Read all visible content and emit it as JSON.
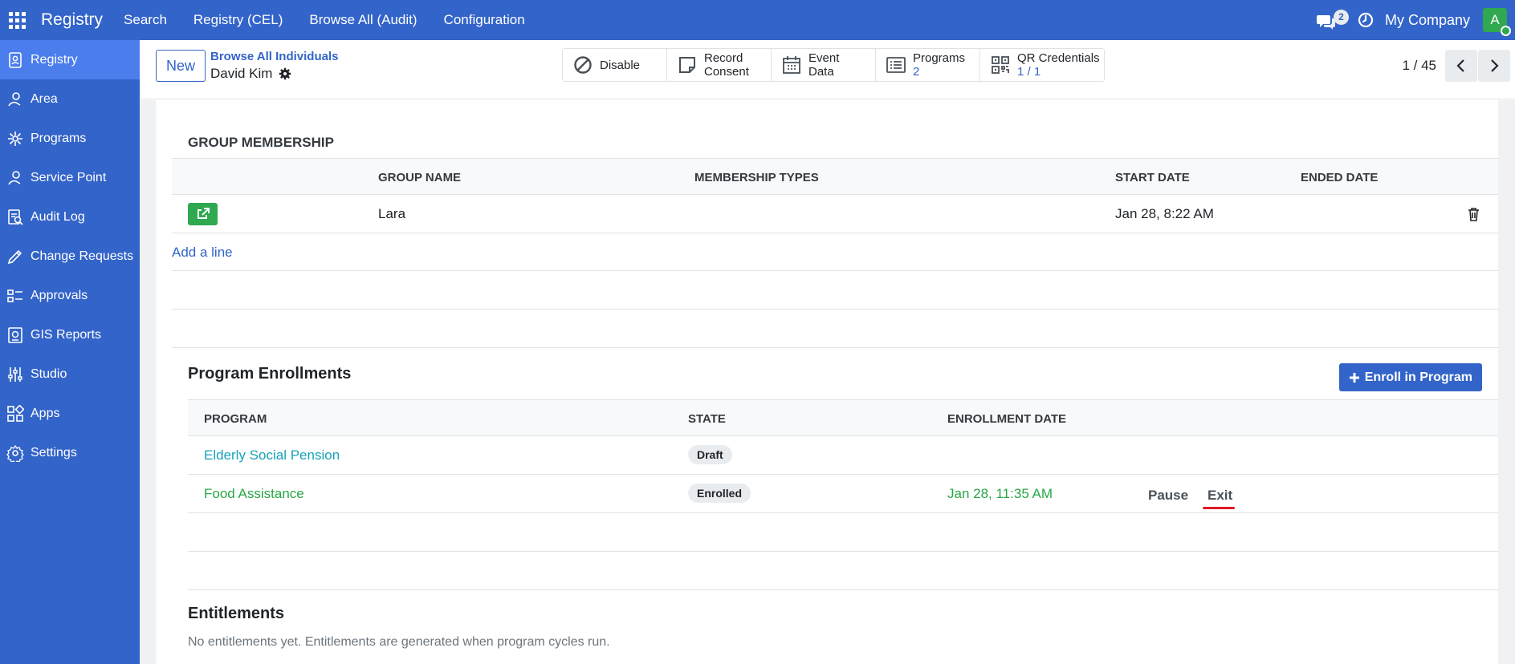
{
  "topbar": {
    "brand": "Registry",
    "menu": [
      "Search",
      "Registry (CEL)",
      "Browse All (Audit)",
      "Configuration"
    ],
    "chat_count": "2",
    "company": "My Company",
    "avatar_letter": "A",
    "icons": [
      "apps-grid-icon",
      "chat-icon",
      "clock-icon"
    ]
  },
  "sidebar": {
    "items": [
      {
        "label": "Registry",
        "icon": "registry-icon",
        "active": true
      },
      {
        "label": "Area",
        "icon": "area-icon"
      },
      {
        "label": "Programs",
        "icon": "programs-icon"
      },
      {
        "label": "Service Point",
        "icon": "service-point-icon"
      },
      {
        "label": "Audit Log",
        "icon": "audit-log-icon"
      },
      {
        "label": "Change Requests",
        "icon": "change-requests-icon"
      },
      {
        "label": "Approvals",
        "icon": "approvals-icon"
      },
      {
        "label": "GIS Reports",
        "icon": "gis-reports-icon"
      },
      {
        "label": "Studio",
        "icon": "studio-icon"
      },
      {
        "label": "Apps",
        "icon": "apps-icon"
      },
      {
        "label": "Settings",
        "icon": "settings-icon"
      }
    ]
  },
  "control": {
    "new_label": "New",
    "breadcrumb_parent": "Browse All Individuals",
    "breadcrumb_current": "David Kim",
    "smart_buttons": {
      "disable": {
        "label": "Disable"
      },
      "record_consent": {
        "line1": "Record",
        "line2": "Consent"
      },
      "event_data": {
        "line1": "Event",
        "line2": "Data"
      },
      "programs": {
        "label": "Programs",
        "value": "2"
      },
      "qr": {
        "label": "QR Credentials",
        "value": "1 / 1"
      }
    },
    "pager": "1 / 45"
  },
  "group_membership": {
    "title": "GROUP MEMBERSHIP",
    "headers": {
      "group_name": "GROUP NAME",
      "membership_types": "MEMBERSHIP TYPES",
      "start_date": "START DATE",
      "ended_date": "ENDED DATE"
    },
    "rows": [
      {
        "group_name": "Lara",
        "membership_types": "",
        "start_date": "Jan 28, 8:22 AM",
        "ended_date": ""
      }
    ],
    "add_line": "Add a line"
  },
  "program_enrollments": {
    "title": "Program Enrollments",
    "enroll_button": "Enroll in Program",
    "headers": {
      "program": "PROGRAM",
      "state": "STATE",
      "enrollment_date": "ENROLLMENT DATE"
    },
    "rows": [
      {
        "program": "Elderly Social Pension",
        "state": "Draft",
        "enrollment_date": ""
      },
      {
        "program": "Food Assistance",
        "state": "Enrolled",
        "enrollment_date": "Jan 28, 11:35 AM",
        "actions": {
          "pause": "Pause",
          "exit": "Exit"
        }
      }
    ]
  },
  "entitlements": {
    "title": "Entitlements",
    "description": "No entitlements yet. Entitlements are generated when program cycles run."
  },
  "colors": {
    "primary": "#3364c9",
    "sidebar_active": "#4b7dec",
    "success": "#2fa84f",
    "teal_link": "#17a2b8",
    "green_link": "#28a745",
    "highlight_underline": "#e01b24"
  }
}
